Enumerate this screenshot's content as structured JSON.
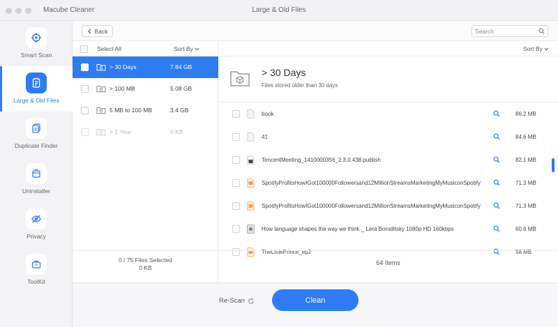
{
  "app": {
    "name": "Macube Cleaner",
    "window_title": "Large & Old Files"
  },
  "sidebar": {
    "accent": "#2f7bf2",
    "items": [
      {
        "label": "Smart Scan",
        "icon": "target-icon",
        "active": false
      },
      {
        "label": "Large & Old Files",
        "icon": "file-icon",
        "active": true
      },
      {
        "label": "Duplicate Finder",
        "icon": "duplicate-icon",
        "active": false
      },
      {
        "label": "Uninstaller",
        "icon": "uninstall-icon",
        "active": false
      },
      {
        "label": "Privacy",
        "icon": "eye-off-icon",
        "active": false
      },
      {
        "label": "ToolKit",
        "icon": "toolkit-icon",
        "active": false
      }
    ]
  },
  "toolbar": {
    "back_label": "Back",
    "search_placeholder": "Search"
  },
  "left_pane": {
    "select_all_label": "Select All",
    "sort_label": "Sort By",
    "categories": [
      {
        "label": "> 30 Days",
        "size": "7.84 GB",
        "selected": true,
        "disabled": false
      },
      {
        "label": "> 100 MB",
        "size": "5.08 GB",
        "selected": false,
        "disabled": false
      },
      {
        "label": "5 MB to 100 MB",
        "size": "3.4 GB",
        "selected": false,
        "disabled": false
      },
      {
        "label": "> 1 Year",
        "size": "0 KB",
        "selected": false,
        "disabled": true
      }
    ],
    "footer_selected": "0 / 75 Files Selected",
    "footer_size": "0 KB"
  },
  "right_pane": {
    "sort_label": "Sort By",
    "title": "> 30 Days",
    "subtitle": "Files stored older than 30 days",
    "files": [
      {
        "name": "book",
        "size": "86.2 MB",
        "icon": "document-icon"
      },
      {
        "name": "41",
        "size": "84.6 MB",
        "icon": "document-icon"
      },
      {
        "name": "TencentMeeting_1410000356_2.3.0.438.publish",
        "size": "82.1 MB",
        "icon": "installer-icon"
      },
      {
        "name": "SpotifyProfitsHowIGot100000Followersand12MillionStreamsMarketingMyMusiconSpotify",
        "size": "71.3 MB",
        "icon": "audio-icon"
      },
      {
        "name": "SpotifyProfitsHowIGot100000Followersand12MillionStreamsMarketingMyMusiconSpotify",
        "size": "71.3 MB",
        "icon": "audio-icon"
      },
      {
        "name": "How language shapes the way we think _ Lera Boroditsky 1080p HD 160kbps",
        "size": "60.6 MB",
        "icon": "video-icon"
      },
      {
        "name": "TheLittlePrince_ep2",
        "size": "58 MB",
        "icon": "audio-icon"
      }
    ],
    "footer_count": "64 Items"
  },
  "actions": {
    "rescan_label": "Re-Scan",
    "clean_label": "Clean"
  }
}
